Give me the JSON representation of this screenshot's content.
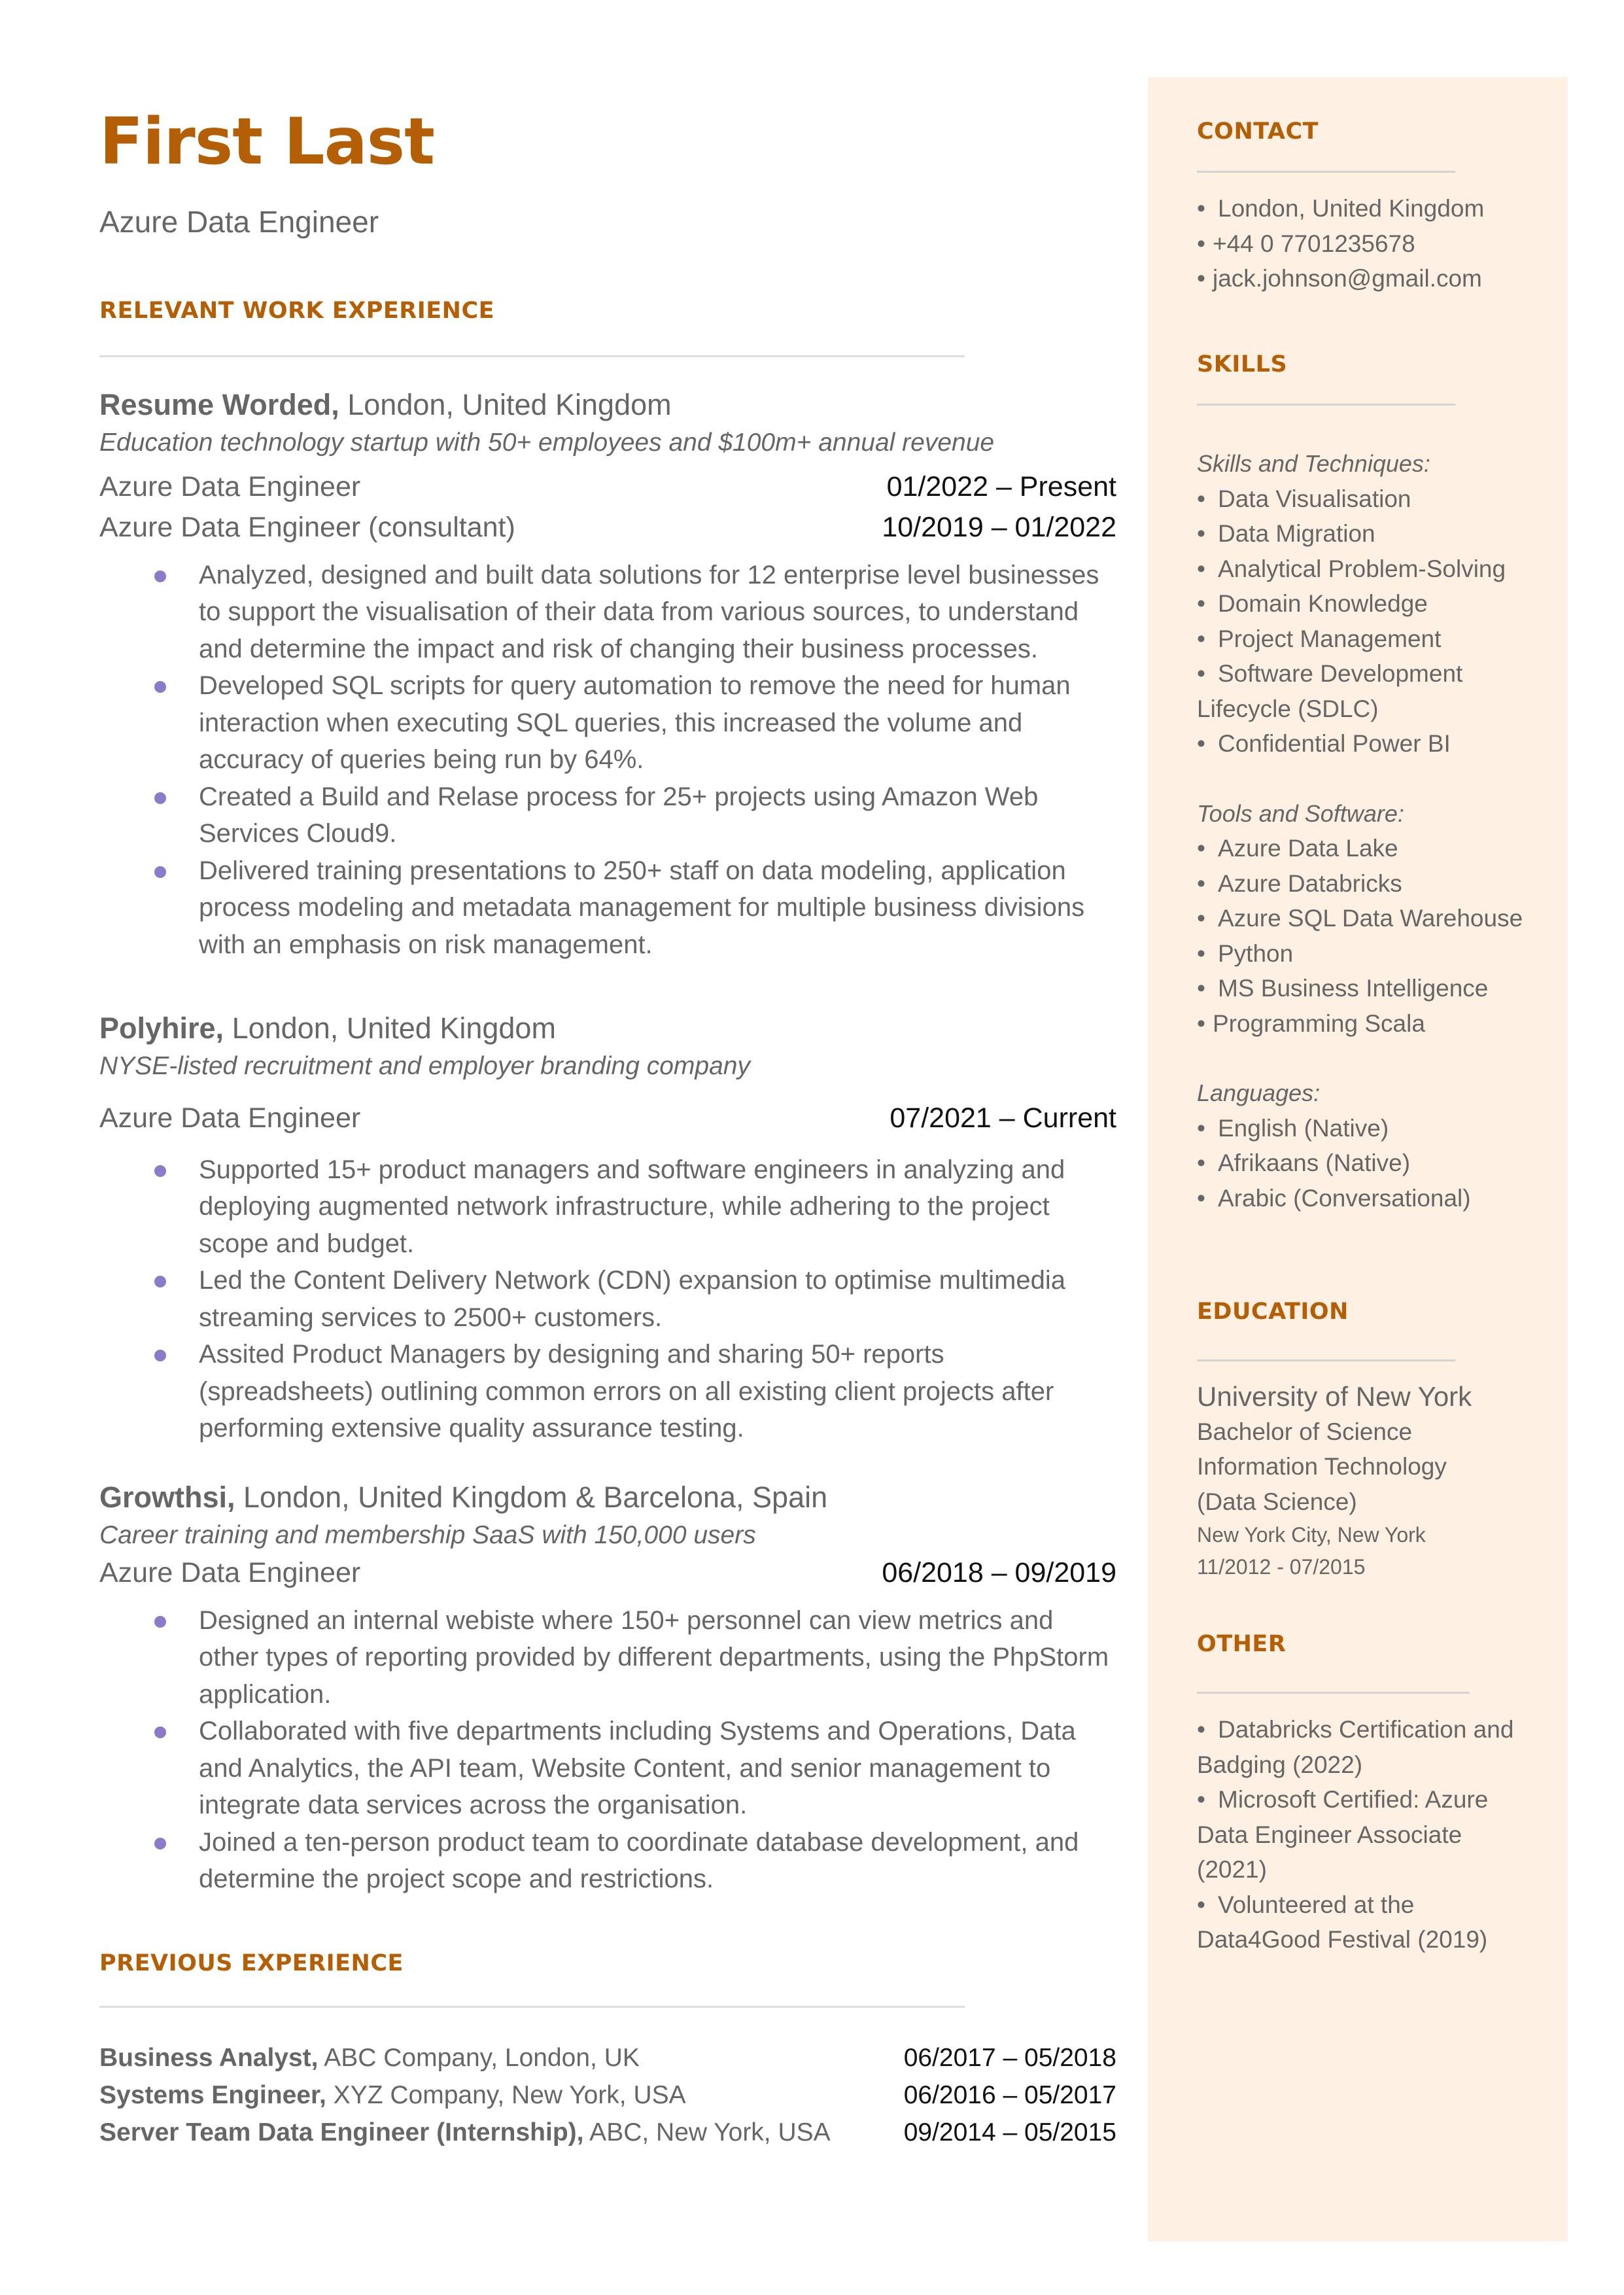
{
  "header": {
    "name": "First Last",
    "title": "Azure Data Engineer"
  },
  "colors": {
    "accent": "#b45f06",
    "bullet": "#8b7bc9",
    "sidebar_bg": "#fef0e2",
    "text": "#666666"
  },
  "relevant": {
    "heading": "RELEVANT WORK EXPERIENCE",
    "jobs": [
      {
        "company": "Resume Worded,",
        "location": " London, United Kingdom",
        "description": "Education technology startup with 50+ employees and $100m+ annual revenue",
        "roles": [
          {
            "title": "Azure Data Engineer",
            "dates": "01/2022 – Present"
          },
          {
            "title": "Azure Data Engineer (consultant)",
            "dates": "10/2019 – 01/2022"
          }
        ],
        "bullets": [
          "Analyzed, designed and built data solutions for 12 enterprise level businesses to support the visualisation of their data from various sources, to understand and determine the impact and risk of changing their business processes.",
          "Developed SQL scripts for query automation to remove the need for human interaction when executing SQL queries, this increased the volume and accuracy of queries being run by 64%.",
          "Created a Build and Relase process for 25+ projects using Amazon Web Services Cloud9.",
          "Delivered training presentations to 250+ staff on data modeling, application process modeling and metadata management for multiple business divisions with an emphasis on risk management."
        ]
      },
      {
        "company": "Polyhire,",
        "location": " London, United Kingdom",
        "description": "NYSE-listed recruitment and employer branding company",
        "roles": [
          {
            "title": "Azure Data Engineer",
            "dates": "07/2021 – Current"
          }
        ],
        "bullets": [
          "Supported 15+ product managers and software engineers in analyzing and deploying augmented network infrastructure, while adhering to the project scope and budget.",
          "Led the Content Delivery Network (CDN) expansion to optimise multimedia streaming services to 2500+ customers.",
          "Assited Product Managers by designing and sharing 50+ reports (spreadsheets) outlining common errors on all existing client projects after performing extensive quality assurance testing."
        ]
      },
      {
        "company": "Growthsi,",
        "location": " London, United Kingdom & Barcelona, Spain",
        "description": "Career training and membership SaaS with 150,000 users",
        "roles": [
          {
            "title": "Azure Data Engineer",
            "dates": "06/2018 – 09/2019"
          }
        ],
        "bullets": [
          "Designed an internal webiste where 150+ personnel can view metrics and other types of reporting provided by different departments, using the PhpStorm application.",
          "Collaborated with five departments including Systems and Operations, Data and Analytics, the API team, Website Content, and senior management to integrate data services across the organisation.",
          "Joined a ten-person product team to coordinate database development, and determine the project scope and restrictions."
        ]
      }
    ]
  },
  "previous": {
    "heading": "PREVIOUS EXPERIENCE",
    "items": [
      {
        "role": "Business Analyst,",
        "place": " ABC Company, London, UK",
        "dates": "06/2017 – 05/2018"
      },
      {
        "role": "Systems Engineer,",
        "place": " XYZ Company, New York, USA",
        "dates": "06/2016 – 05/2017"
      },
      {
        "role": "Server Team Data Engineer (Internship),",
        "place": " ABC, New York, USA",
        "dates": "09/2014 – 05/2015"
      }
    ]
  },
  "sidebar": {
    "contact": {
      "heading": "CONTACT",
      "items": [
        "London, United Kingdom",
        "+44 0 7701235678",
        "jack.johnson@gmail.com"
      ]
    },
    "skills": {
      "heading": "SKILLS",
      "techniques_label": "Skills and Techniques:",
      "techniques": [
        "Data Visualisation",
        "Data Migration",
        "Analytical Problem-Solving",
        "Domain Knowledge",
        "Project Management",
        "Software Development",
        "Confidential Power BI"
      ],
      "techniques_wrap": "Lifecycle (SDLC)",
      "tools_label": "Tools and Software:",
      "tools": [
        "Azure Data Lake",
        "Azure Databricks",
        "Azure SQL Data Warehouse",
        "Python",
        "MS Business Intelligence",
        "Programming Scala"
      ],
      "languages_label": "Languages:",
      "languages": [
        "English (Native)",
        "Afrikaans (Native)",
        "Arabic (Conversational)"
      ]
    },
    "education": {
      "heading": "EDUCATION",
      "school": "University of New York",
      "degree_lines": [
        "Bachelor of Science",
        "Information Technology",
        "(Data Science)"
      ],
      "location": "New York City, New York",
      "dates": "11/2012 - 07/2015"
    },
    "other": {
      "heading": "OTHER",
      "items": [
        {
          "first": "Databricks Certification and",
          "rest": "Badging (2022)"
        },
        {
          "first": "Microsoft Certified: Azure",
          "rest": "Data Engineer Associate (2021)"
        },
        {
          "first": "Volunteered at the",
          "rest": "Data4Good Festival (2019)"
        }
      ]
    }
  }
}
